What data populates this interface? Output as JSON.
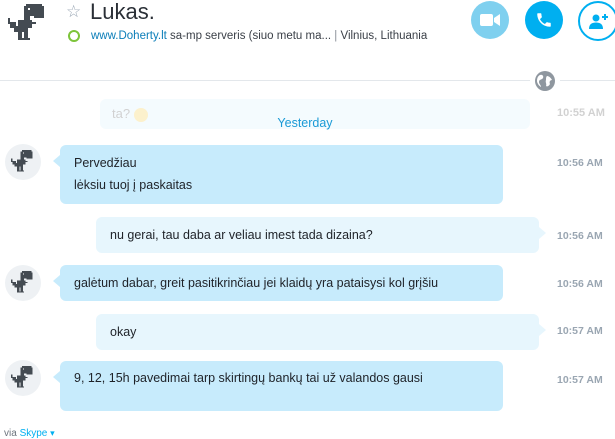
{
  "header": {
    "contact_name": "Lukas.",
    "mood_link": "www.Doherty.lt",
    "mood_text": " sa-mp serveris (siuo metu ma...",
    "separator": "|",
    "location": "Vilnius, Lithuania",
    "icons": {
      "favorite": "star-icon",
      "status": "online-status-icon",
      "video": "video-camera-icon",
      "call": "phone-icon",
      "add": "add-contact-icon",
      "translate": "globe-icon"
    },
    "colors": {
      "accent": "#00aff0",
      "video": "#7fd0ef",
      "online": "#7dc43a"
    }
  },
  "conversation": {
    "faded_message": {
      "text": "ta?",
      "time": "10:55 AM"
    },
    "day_separator": "Yesterday",
    "messages": [
      {
        "direction": "in",
        "lines": [
          "Pervedžiau",
          "lėksiu tuoj į paskaitas"
        ],
        "time": "10:56 AM"
      },
      {
        "direction": "out",
        "lines": [
          "nu gerai, tau daba ar veliau imest tada dizaina?"
        ],
        "time": "10:56 AM"
      },
      {
        "direction": "in",
        "lines": [
          "galėtum dabar, greit pasitikrinčiau jei klaidų yra pataisysi kol grįšiu"
        ],
        "time": "10:56 AM"
      },
      {
        "direction": "out",
        "lines": [
          "okay"
        ],
        "time": "10:57 AM"
      },
      {
        "direction": "in",
        "lines": [
          "9, 12, 15h pavedimai tarp skirtingų bankų tai už valandos gausi"
        ],
        "time": "10:57 AM"
      }
    ],
    "colors": {
      "incoming_bubble": "#c7ebfc",
      "outgoing_bubble": "#e7f6fd"
    }
  },
  "footer": {
    "via_text": "via ",
    "skype_link": "Skype"
  }
}
